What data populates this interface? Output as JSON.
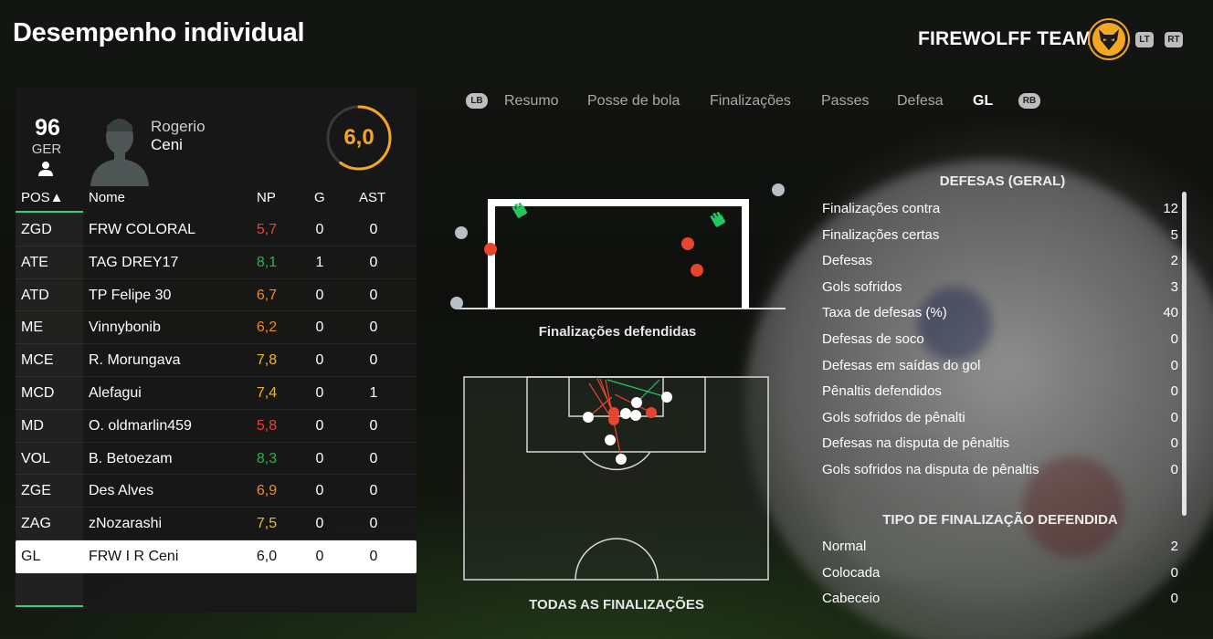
{
  "header": {
    "title": "Desempenho individual",
    "team_name": "FIREWOLFF TEAM",
    "lt_label": "LT",
    "rt_label": "RT"
  },
  "player": {
    "overall": "96",
    "nation": "GER",
    "first_name": "Rogerio",
    "last_name": "Ceni",
    "rating": "6,0",
    "rating_fraction": 0.6,
    "rating_color": "#f5a623"
  },
  "table": {
    "headers": {
      "pos": "POS▲",
      "name": "Nome",
      "np": "NP",
      "g": "G",
      "ast": "AST"
    },
    "rows": [
      {
        "pos": "ZGD",
        "name": "FRW COLORAL",
        "np": "5,7",
        "np_color": "#e8452f",
        "g": "0",
        "ast": "0"
      },
      {
        "pos": "ATE",
        "name": "TAG DREY17",
        "np": "8,1",
        "np_color": "#2bb34a",
        "g": "1",
        "ast": "0"
      },
      {
        "pos": "ATD",
        "name": "TP Felipe 30",
        "np": "6,7",
        "np_color": "#f08a24",
        "g": "0",
        "ast": "0"
      },
      {
        "pos": "ME",
        "name": "Vinnybonib",
        "np": "6,2",
        "np_color": "#f08a24",
        "g": "0",
        "ast": "0"
      },
      {
        "pos": "MCE",
        "name": "R. Morungava",
        "np": "7,8",
        "np_color": "#f0b824",
        "g": "0",
        "ast": "0"
      },
      {
        "pos": "MCD",
        "name": "Alefagui",
        "np": "7,4",
        "np_color": "#f0b824",
        "g": "0",
        "ast": "1"
      },
      {
        "pos": "MD",
        "name": "O. oldmarlin459",
        "np": "5,8",
        "np_color": "#e8452f",
        "g": "0",
        "ast": "0"
      },
      {
        "pos": "VOL",
        "name": "B. Betoezam",
        "np": "8,3",
        "np_color": "#2bb34a",
        "g": "0",
        "ast": "0"
      },
      {
        "pos": "ZGE",
        "name": "Des Alves",
        "np": "6,9",
        "np_color": "#f08a24",
        "g": "0",
        "ast": "0"
      },
      {
        "pos": "ZAG",
        "name": "zNozarashi",
        "np": "7,5",
        "np_color": "#f0b824",
        "g": "0",
        "ast": "0"
      },
      {
        "pos": "GL",
        "name": "FRW I R Ceni",
        "np": "6,0",
        "np_color": "#111111",
        "g": "0",
        "ast": "0",
        "selected": true
      }
    ]
  },
  "tabs": {
    "lb_label": "LB",
    "rb_label": "RB",
    "items": [
      "Resumo",
      "Posse de bola",
      "Finalizações",
      "Passes",
      "Defesa",
      "GL"
    ],
    "active": "GL"
  },
  "goal_section": {
    "caption": "Finalizações defendidas"
  },
  "pitch_section": {
    "caption": "TODAS AS FINALIZAÇÕES"
  },
  "defense_stats": {
    "title": "DEFESAS (GERAL)",
    "rows": [
      {
        "label": "Finalizações contra",
        "value": "12"
      },
      {
        "label": "Finalizações certas",
        "value": "5"
      },
      {
        "label": "Defesas",
        "value": "2"
      },
      {
        "label": "Gols sofridos",
        "value": "3"
      },
      {
        "label": "Taxa de defesas (%)",
        "value": "40"
      },
      {
        "label": "Defesas de soco",
        "value": "0"
      },
      {
        "label": "Defesas em saídas do gol",
        "value": "0"
      },
      {
        "label": "Pênaltis defendidos",
        "value": "0"
      },
      {
        "label": "Gols sofridos de pênalti",
        "value": "0"
      },
      {
        "label": "Defesas na disputa de pênaltis",
        "value": "0"
      },
      {
        "label": "Gols sofridos na disputa de pênaltis",
        "value": "0"
      }
    ]
  },
  "shot_types": {
    "title": "TIPO DE FINALIZAÇÃO DEFENDIDA",
    "rows": [
      {
        "label": "Normal",
        "value": "2"
      },
      {
        "label": "Colocada",
        "value": "0"
      },
      {
        "label": "Cabeceio",
        "value": "0"
      }
    ]
  },
  "colors": {
    "accent_green": "#2fd17f",
    "goal_red": "#e8452f",
    "save_green": "#22c55e",
    "rating_orange": "#f5a623"
  }
}
